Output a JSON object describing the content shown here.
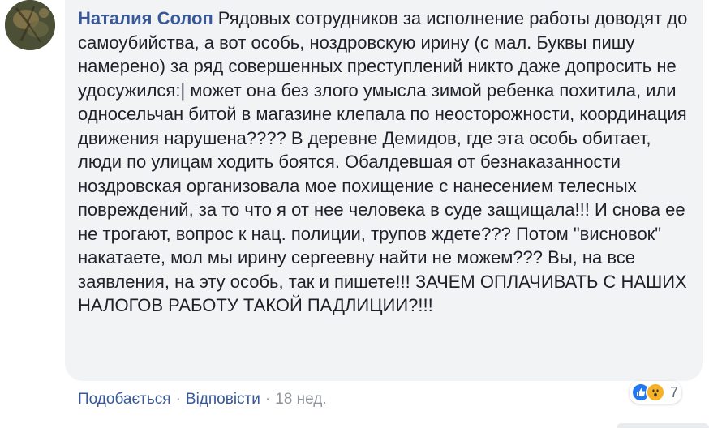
{
  "comment": {
    "author": "Наталия Солоп",
    "text": "Рядовых сотрудников за исполнение работы доводят до самоубийства, а вот особь, ноздровскую ирину (с мал. Буквы пишу намерено) за ряд совершенных преступлений никто даже допросить не удосужился:| может она без злого умысла зимой ребенка похитила, или односельчан битой в магазине клепала по неосторожности, координация движения нарушена???? В деревне Демидов, где эта особь обитает, люди по улицам ходить боятся. Обалдевшая от безнаказанности ноздровская организовала мое похищение с нанесением телесных повреждений, за то что я от нее человека в суде защищала!!! И снова ее не трогают, вопрос к нац. полиции, трупов ждете??? Потом \"висновок\" накатаете, мол мы ирину сергеевну найти не можем??? Вы, на все заявления, на эту особь, так и пишете!!! ЗАЧЕМ ОПЛАЧИВАТЬ С НАШИХ НАЛОГОВ РАБОТУ ТАКОЙ ПАДЛИЦИИ?!!!"
  },
  "reactions": {
    "icons": [
      "like-icon",
      "wow-icon"
    ],
    "count": "7",
    "like_color": "#2078f4",
    "wow_color": "#f7b125"
  },
  "actions": {
    "like_label": "Подобається",
    "separator_1": "·",
    "reply_label": "Відповісти",
    "separator_2": "·",
    "timestamp": "18 нед."
  },
  "colors": {
    "link": "#385898",
    "text": "#1d2129",
    "meta": "#90949c",
    "bubble": "#f2f3f5"
  }
}
